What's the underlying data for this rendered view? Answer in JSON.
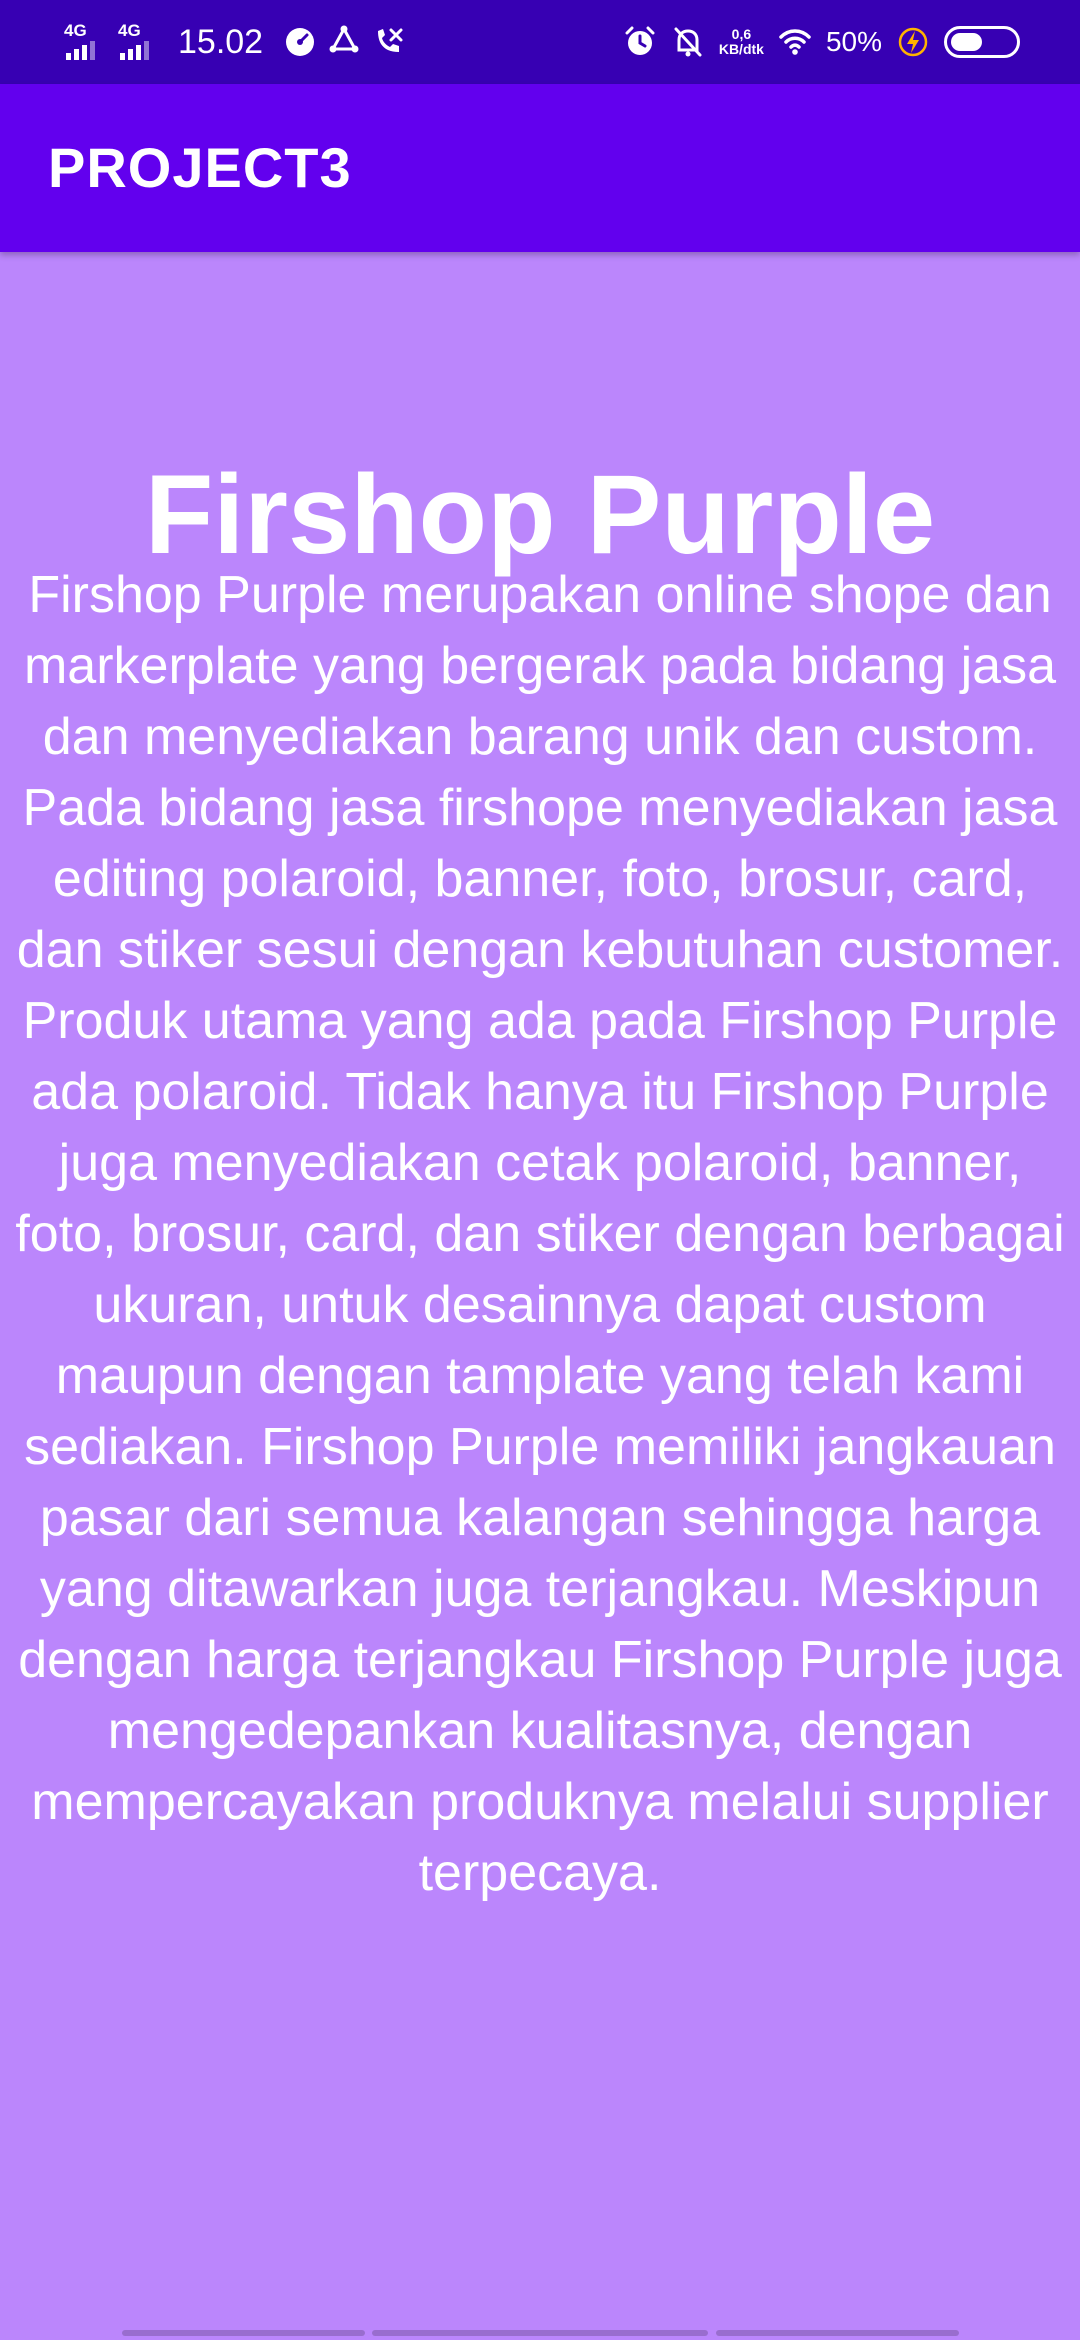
{
  "status_bar": {
    "signal1": "4G",
    "signal2": "4G",
    "time": "15.02",
    "speed_value": "0,6",
    "speed_unit": "KB/dtk",
    "battery_pct": "50%",
    "battery_level": 0.5,
    "icons": {
      "left": [
        "speedometer-icon",
        "sync-icon",
        "missed-call-icon"
      ],
      "right": [
        "alarm-icon",
        "notifications-off-icon",
        "wifi-icon",
        "charging-icon",
        "battery-icon"
      ]
    }
  },
  "app_bar": {
    "title": "PROJECT3"
  },
  "main": {
    "heading": "Firshop Purple",
    "description": "Firshop Purple merupakan online shope dan markerplate yang bergerak pada bidang jasa dan menyediakan barang unik dan custom. Pada bidang jasa firshope menyediakan jasa editing polaroid, banner, foto, brosur, card, dan stiker sesui dengan kebutuhan customer. Produk utama yang ada pada Firshop Purple ada polaroid. Tidak hanya itu Firshop Purple juga menyediakan cetak polaroid, banner, foto, brosur, card, dan stiker dengan berbagai ukuran, untuk desainnya dapat custom maupun dengan tamplate yang telah kami sediakan. Firshop Purple memiliki jangkauan pasar dari semua kalangan sehingga harga yang ditawarkan juga terjangkau. Meskipun dengan harga terjangkau Firshop Purple juga mengedepankan kualitasnya, dengan mempercayakan produknya melalui supplier terpecaya."
  },
  "colors": {
    "status_bar": "#3700b3",
    "app_bar": "#6200ee",
    "background": "#bb86fc",
    "text": "#ffffff",
    "charging": "#ffb300"
  }
}
